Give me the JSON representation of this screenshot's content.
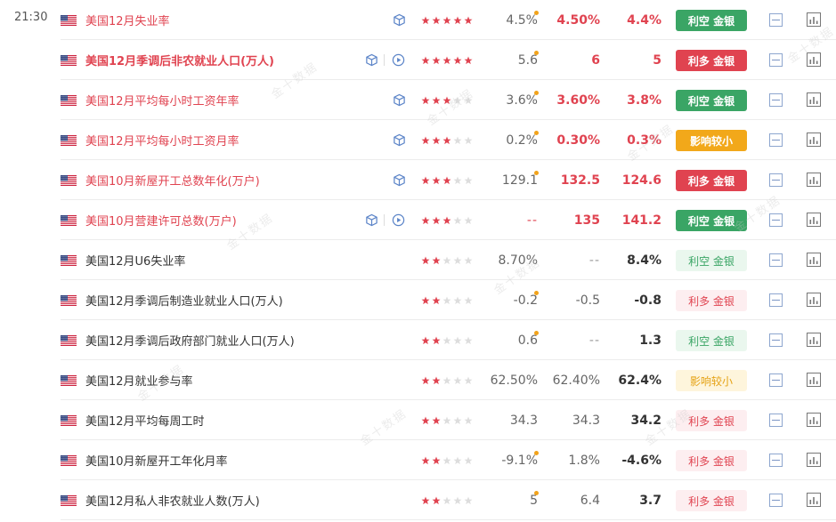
{
  "time": "21:30",
  "colors": {
    "red": "#e04350",
    "green": "#3aa565",
    "yellow": "#f2a81a",
    "star": "#e04350",
    "star_empty": "#dddddd",
    "dot": "#f2a31a"
  },
  "watermark": "金十数据",
  "rows": [
    {
      "name": "美国12月失业率",
      "important": true,
      "bold": false,
      "icons": [
        "cube-icon"
      ],
      "stars": 5,
      "previous": "4.5%",
      "prev_dot": true,
      "forecast": "4.50%",
      "actual": "4.4%",
      "badge": "利空 金银",
      "badge_style": "good-s"
    },
    {
      "name": "美国12月季调后非农就业人口(万人)",
      "important": true,
      "bold": true,
      "icons": [
        "cube-icon",
        "play-icon"
      ],
      "stars": 5,
      "previous": "5.6",
      "prev_dot": true,
      "forecast": "6",
      "actual": "5",
      "badge": "利多 金银",
      "badge_style": "bad-s"
    },
    {
      "name": "美国12月平均每小时工资年率",
      "important": true,
      "bold": false,
      "icons": [
        "cube-icon"
      ],
      "stars": 3,
      "previous": "3.6%",
      "prev_dot": true,
      "forecast": "3.60%",
      "actual": "3.8%",
      "badge": "利空 金银",
      "badge_style": "good-s"
    },
    {
      "name": "美国12月平均每小时工资月率",
      "important": true,
      "bold": false,
      "icons": [
        "cube-icon"
      ],
      "stars": 3,
      "previous": "0.2%",
      "prev_dot": true,
      "forecast": "0.30%",
      "actual": "0.3%",
      "badge": "影响较小",
      "badge_style": "mid-s"
    },
    {
      "name": "美国10月新屋开工总数年化(万户)",
      "important": true,
      "bold": false,
      "icons": [
        "cube-icon"
      ],
      "stars": 3,
      "previous": "129.1",
      "prev_dot": true,
      "forecast": "132.5",
      "actual": "124.6",
      "badge": "利多 金银",
      "badge_style": "bad-s"
    },
    {
      "name": "美国10月营建许可总数(万户)",
      "important": true,
      "bold": false,
      "icons": [
        "cube-icon",
        "play-icon"
      ],
      "stars": 3,
      "previous": "--",
      "prev_dot": false,
      "forecast": "135",
      "actual": "141.2",
      "badge": "利空 金银",
      "badge_style": "good-s"
    },
    {
      "name": "美国12月U6失业率",
      "important": false,
      "bold": false,
      "icons": [],
      "stars": 2,
      "previous": "8.70%",
      "prev_dot": false,
      "forecast": "--",
      "actual": "8.4%",
      "badge": "利空 金银",
      "badge_style": "good-l"
    },
    {
      "name": "美国12月季调后制造业就业人口(万人)",
      "important": false,
      "bold": false,
      "icons": [],
      "stars": 2,
      "previous": "-0.2",
      "prev_dot": true,
      "forecast": "-0.5",
      "actual": "-0.8",
      "badge": "利多 金银",
      "badge_style": "bad-l"
    },
    {
      "name": "美国12月季调后政府部门就业人口(万人)",
      "important": false,
      "bold": false,
      "icons": [],
      "stars": 2,
      "previous": "0.6",
      "prev_dot": true,
      "forecast": "--",
      "actual": "1.3",
      "badge": "利空 金银",
      "badge_style": "good-l"
    },
    {
      "name": "美国12月就业参与率",
      "important": false,
      "bold": false,
      "icons": [],
      "stars": 2,
      "previous": "62.50%",
      "prev_dot": false,
      "forecast": "62.40%",
      "actual": "62.4%",
      "badge": "影响较小",
      "badge_style": "mid-l"
    },
    {
      "name": "美国12月平均每周工时",
      "important": false,
      "bold": false,
      "icons": [],
      "stars": 2,
      "previous": "34.3",
      "prev_dot": false,
      "forecast": "34.3",
      "actual": "34.2",
      "badge": "利多 金银",
      "badge_style": "bad-l"
    },
    {
      "name": "美国10月新屋开工年化月率",
      "important": false,
      "bold": false,
      "icons": [],
      "stars": 2,
      "previous": "-9.1%",
      "prev_dot": true,
      "forecast": "1.8%",
      "actual": "-4.6%",
      "badge": "利多 金银",
      "badge_style": "bad-l"
    },
    {
      "name": "美国12月私人非农就业人数(万人)",
      "important": false,
      "bold": false,
      "icons": [],
      "stars": 2,
      "previous": "5",
      "prev_dot": true,
      "forecast": "6.4",
      "actual": "3.7",
      "badge": "利多 金银",
      "badge_style": "bad-l"
    }
  ]
}
